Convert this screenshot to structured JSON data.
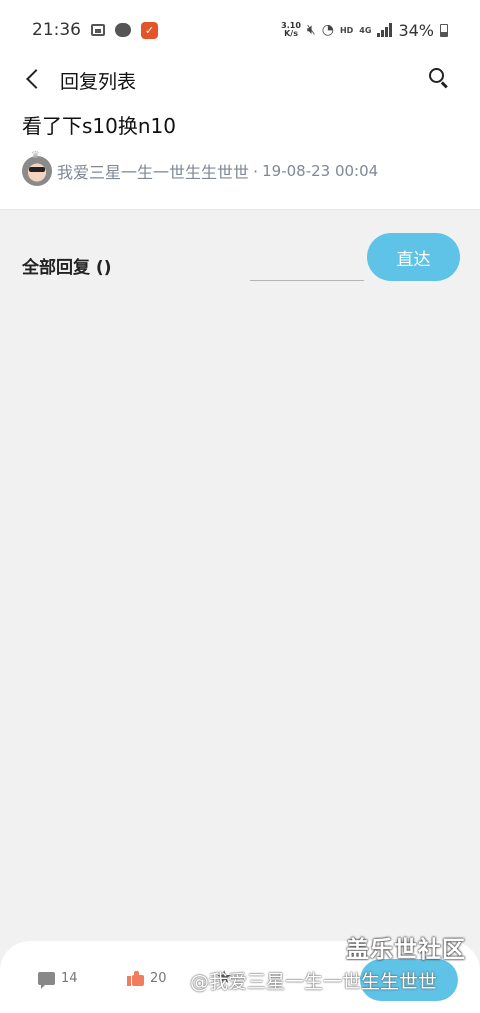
{
  "status_bar": {
    "time": "21:36",
    "net_speed_value": "3.10",
    "net_speed_unit": "K/s",
    "hd": "HD",
    "network": "4G",
    "battery": "34%"
  },
  "header": {
    "title": "回复列表",
    "icons": {
      "back": "back-arrow-icon",
      "search": "search-icon"
    }
  },
  "post": {
    "title": "看了下s10换n10",
    "author": "我爱三星一生一世生生世世",
    "separator": "·",
    "date": "19-08-23 00:04"
  },
  "replies": {
    "label": "全部回复 ()",
    "page_input_value": "",
    "go_button": "直达"
  },
  "bottom_bar": {
    "comment_count": "14",
    "like_count": "20",
    "like_color": "#f07d5d",
    "accent": "#5ec3e6"
  },
  "watermark": {
    "logo": "盖乐世社区",
    "user": "@我爱三星一生一世生生世世"
  }
}
